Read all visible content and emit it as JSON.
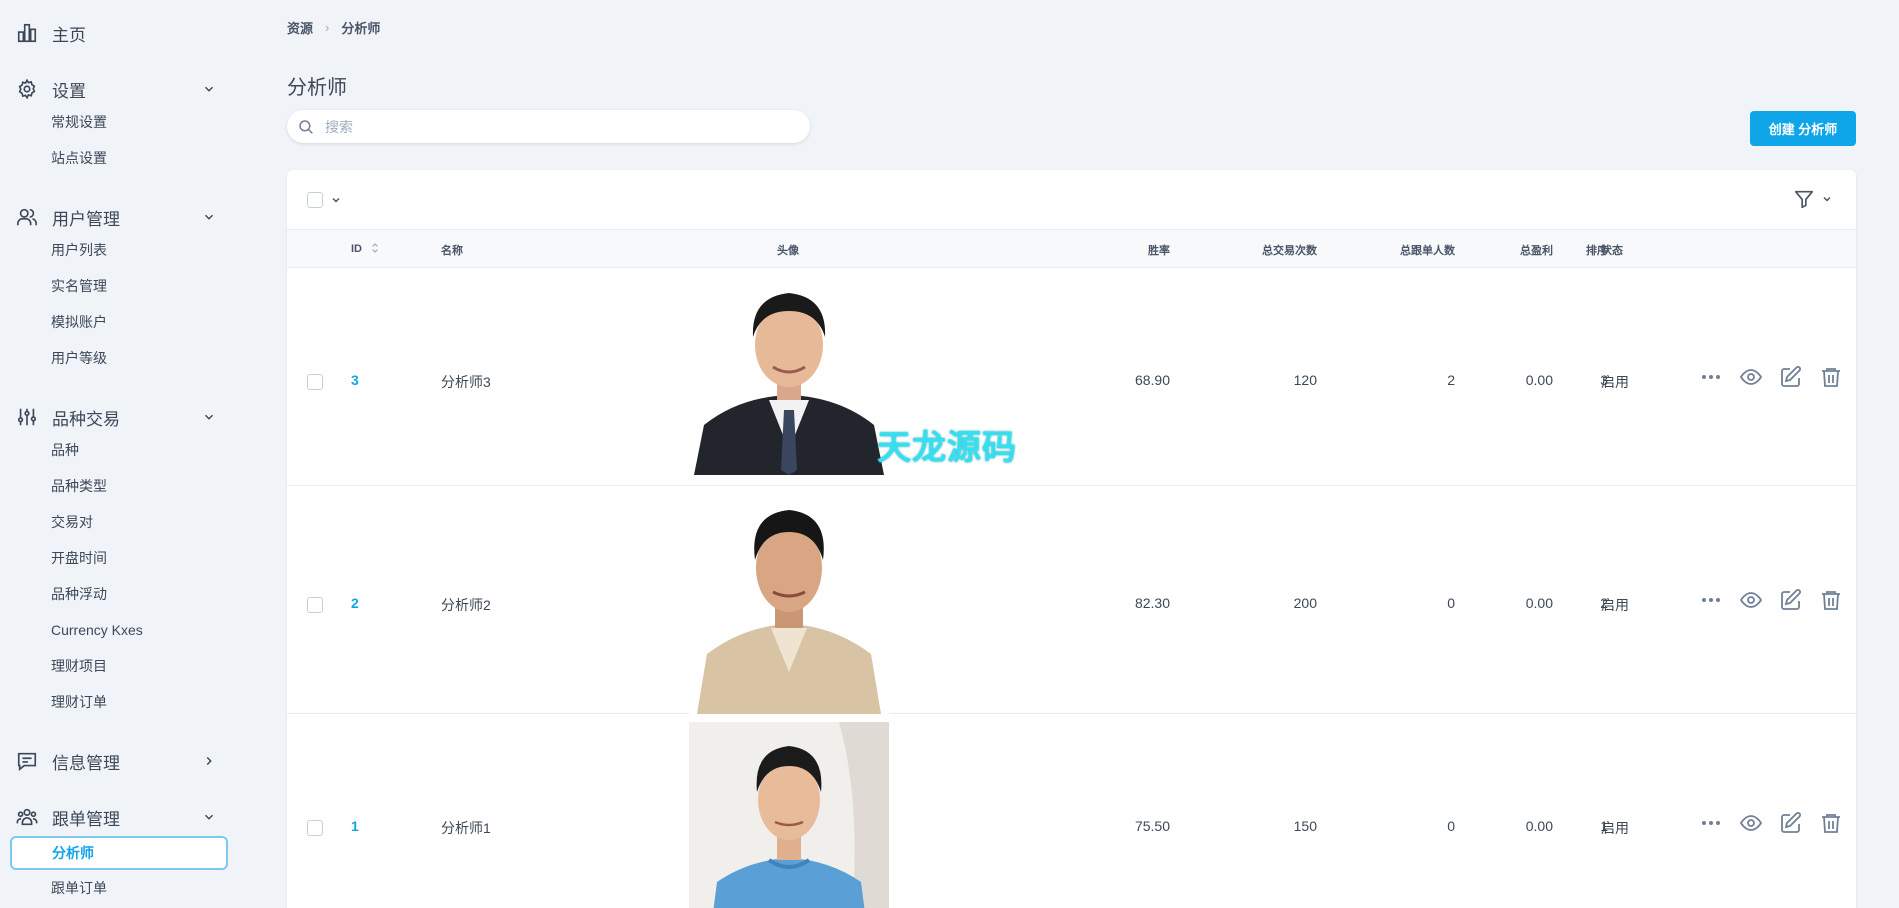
{
  "sidebar": {
    "home": "主页",
    "settings": {
      "label": "设置",
      "items": [
        "常规设置",
        "站点设置"
      ]
    },
    "users": {
      "label": "用户管理",
      "items": [
        "用户列表",
        "实名管理",
        "模拟账户",
        "用户等级"
      ]
    },
    "trading": {
      "label": "品种交易",
      "items": [
        "品种",
        "品种类型",
        "交易对",
        "开盘时间",
        "品种浮动",
        "Currency Kxes",
        "理财项目",
        "理财订单"
      ]
    },
    "messages": {
      "label": "信息管理"
    },
    "copytrade": {
      "label": "跟单管理",
      "items": [
        "分析师",
        "跟单订单"
      ]
    }
  },
  "breadcrumb": {
    "root": "资源",
    "current": "分析师"
  },
  "page": {
    "title": "分析师",
    "search_placeholder": "搜索",
    "create_button": "创建 分析师"
  },
  "table": {
    "headers": {
      "id": "ID",
      "name": "名称",
      "avatar": "头像",
      "win_rate": "胜率",
      "total_trades": "总交易次数",
      "total_followers": "总跟单人数",
      "total_profit": "总盈利",
      "sort": "排序",
      "status": "状态"
    },
    "rows": [
      {
        "id": "3",
        "name": "分析师3",
        "win_rate": "68.90",
        "total_trades": "120",
        "total_followers": "2",
        "total_profit": "0.00",
        "sort": "3",
        "status": "启用"
      },
      {
        "id": "2",
        "name": "分析师2",
        "win_rate": "82.30",
        "total_trades": "200",
        "total_followers": "0",
        "total_profit": "0.00",
        "sort": "2",
        "status": "启用"
      },
      {
        "id": "1",
        "name": "分析师1",
        "win_rate": "75.50",
        "total_trades": "150",
        "total_followers": "0",
        "total_profit": "0.00",
        "sort": "1",
        "status": "启用"
      }
    ]
  },
  "watermark": "天龙源码",
  "colors": {
    "accent": "#0ea5e9",
    "background": "#f0f4f8"
  }
}
